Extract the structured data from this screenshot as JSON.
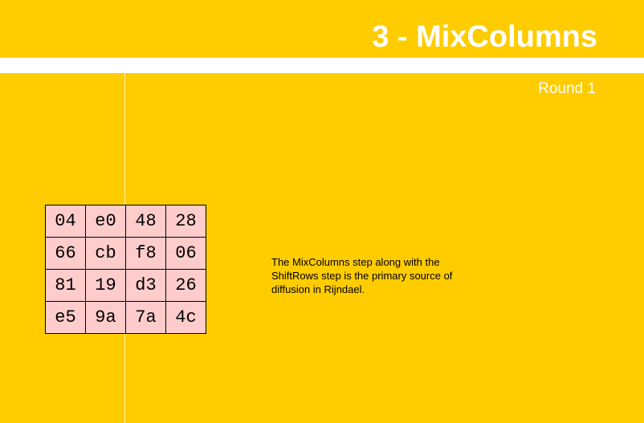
{
  "slide": {
    "title": "3 - MixColumns",
    "subtitle": "Round 1",
    "description": "The MixColumns step along with the ShiftRows step is the primary source of diffusion in Rijndael."
  },
  "state_matrix": [
    [
      "04",
      "e0",
      "48",
      "28"
    ],
    [
      "66",
      "cb",
      "f8",
      "06"
    ],
    [
      "81",
      "19",
      "d3",
      "26"
    ],
    [
      "e5",
      "9a",
      "7a",
      "4c"
    ]
  ],
  "colors": {
    "background": "#ffcc00",
    "cell_fill": "#ffcccc",
    "title_text": "#ffffff"
  }
}
